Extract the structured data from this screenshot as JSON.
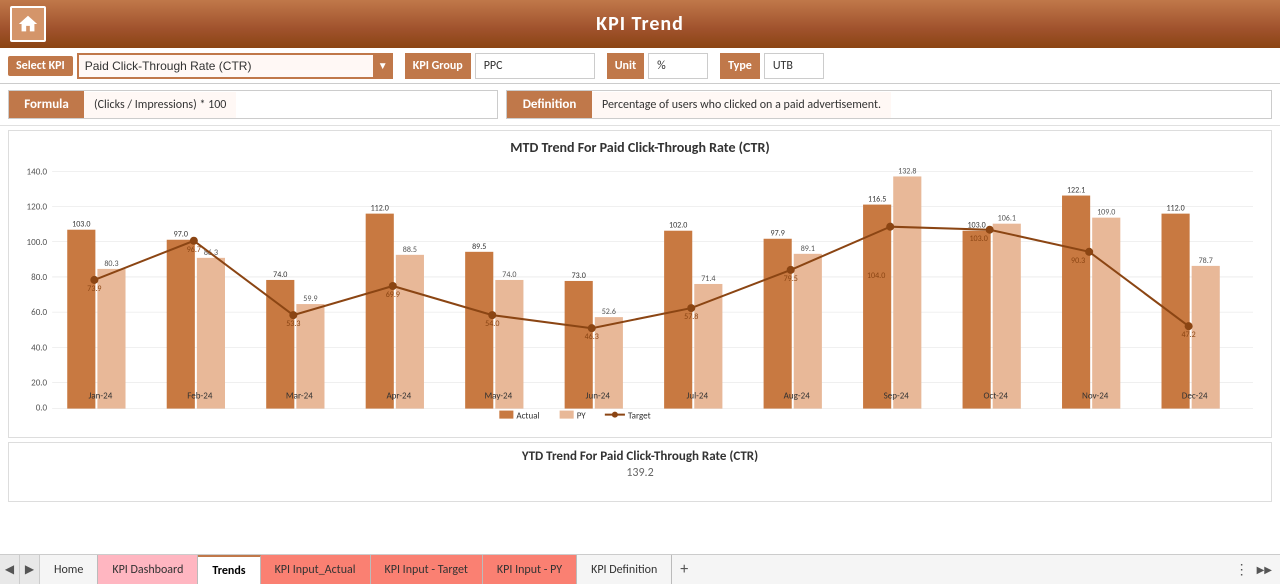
{
  "header": {
    "title": "KPI Trend",
    "home_label": "Home"
  },
  "top_bar": {
    "select_kpi_label": "Select KPI",
    "selected_kpi": "Paid Click-Through Rate (CTR)",
    "kpi_group_label": "KPI Group",
    "kpi_group_value": "PPC",
    "unit_label": "Unit",
    "unit_value": "%",
    "type_label": "Type",
    "type_value": "UTB"
  },
  "formula": {
    "label": "Formula",
    "value": "(Clicks / Impressions) * 100"
  },
  "definition": {
    "label": "Definition",
    "value": "Percentage of users who clicked on a paid advertisement."
  },
  "mtd_chart": {
    "title": "MTD Trend For Paid Click-Through Rate (CTR)",
    "y_max": 140.0,
    "y_min": 0.0,
    "y_step": 20.0,
    "months": [
      "Jan-24",
      "Feb-24",
      "Mar-24",
      "Apr-24",
      "May-24",
      "Jun-24",
      "Jul-24",
      "Aug-24",
      "Sep-24",
      "Oct-24",
      "Nov-24",
      "Dec-24"
    ],
    "actual": [
      103.0,
      97.0,
      74.0,
      112.0,
      89.5,
      73.0,
      102.0,
      97.9,
      116.5,
      103.0,
      122.1,
      112.0
    ],
    "py": [
      80.3,
      86.3,
      59.9,
      88.5,
      74.0,
      52.6,
      71.4,
      89.1,
      132.8,
      106.1,
      109.0,
      78.7
    ],
    "target": [
      73.9,
      96.7,
      53.3,
      69.9,
      54.0,
      46.3,
      57.8,
      79.5,
      104.0,
      103.0,
      90.3,
      47.2
    ],
    "legend": {
      "actual": "Actual",
      "py": "PY",
      "target": "Target"
    }
  },
  "ytd_chart": {
    "title": "YTD Trend For Paid Click-Through Rate (CTR)",
    "first_value": "139.2"
  },
  "tabs": [
    {
      "label": "Home",
      "active": false,
      "style": "normal"
    },
    {
      "label": "KPI Dashboard",
      "active": false,
      "style": "pink"
    },
    {
      "label": "Trends",
      "active": true,
      "style": "orange"
    },
    {
      "label": "KPI Input_Actual",
      "active": false,
      "style": "salmon"
    },
    {
      "label": "KPI Input - Target",
      "active": false,
      "style": "salmon"
    },
    {
      "label": "KPI Input - PY",
      "active": false,
      "style": "salmon"
    },
    {
      "label": "KPI Definition",
      "active": false,
      "style": "normal"
    }
  ],
  "colors": {
    "actual_bar": "#c87941",
    "py_bar": "#e8b898",
    "target_line": "#c0784a",
    "header_bg": "#a0522d",
    "accent": "#c0784a"
  }
}
